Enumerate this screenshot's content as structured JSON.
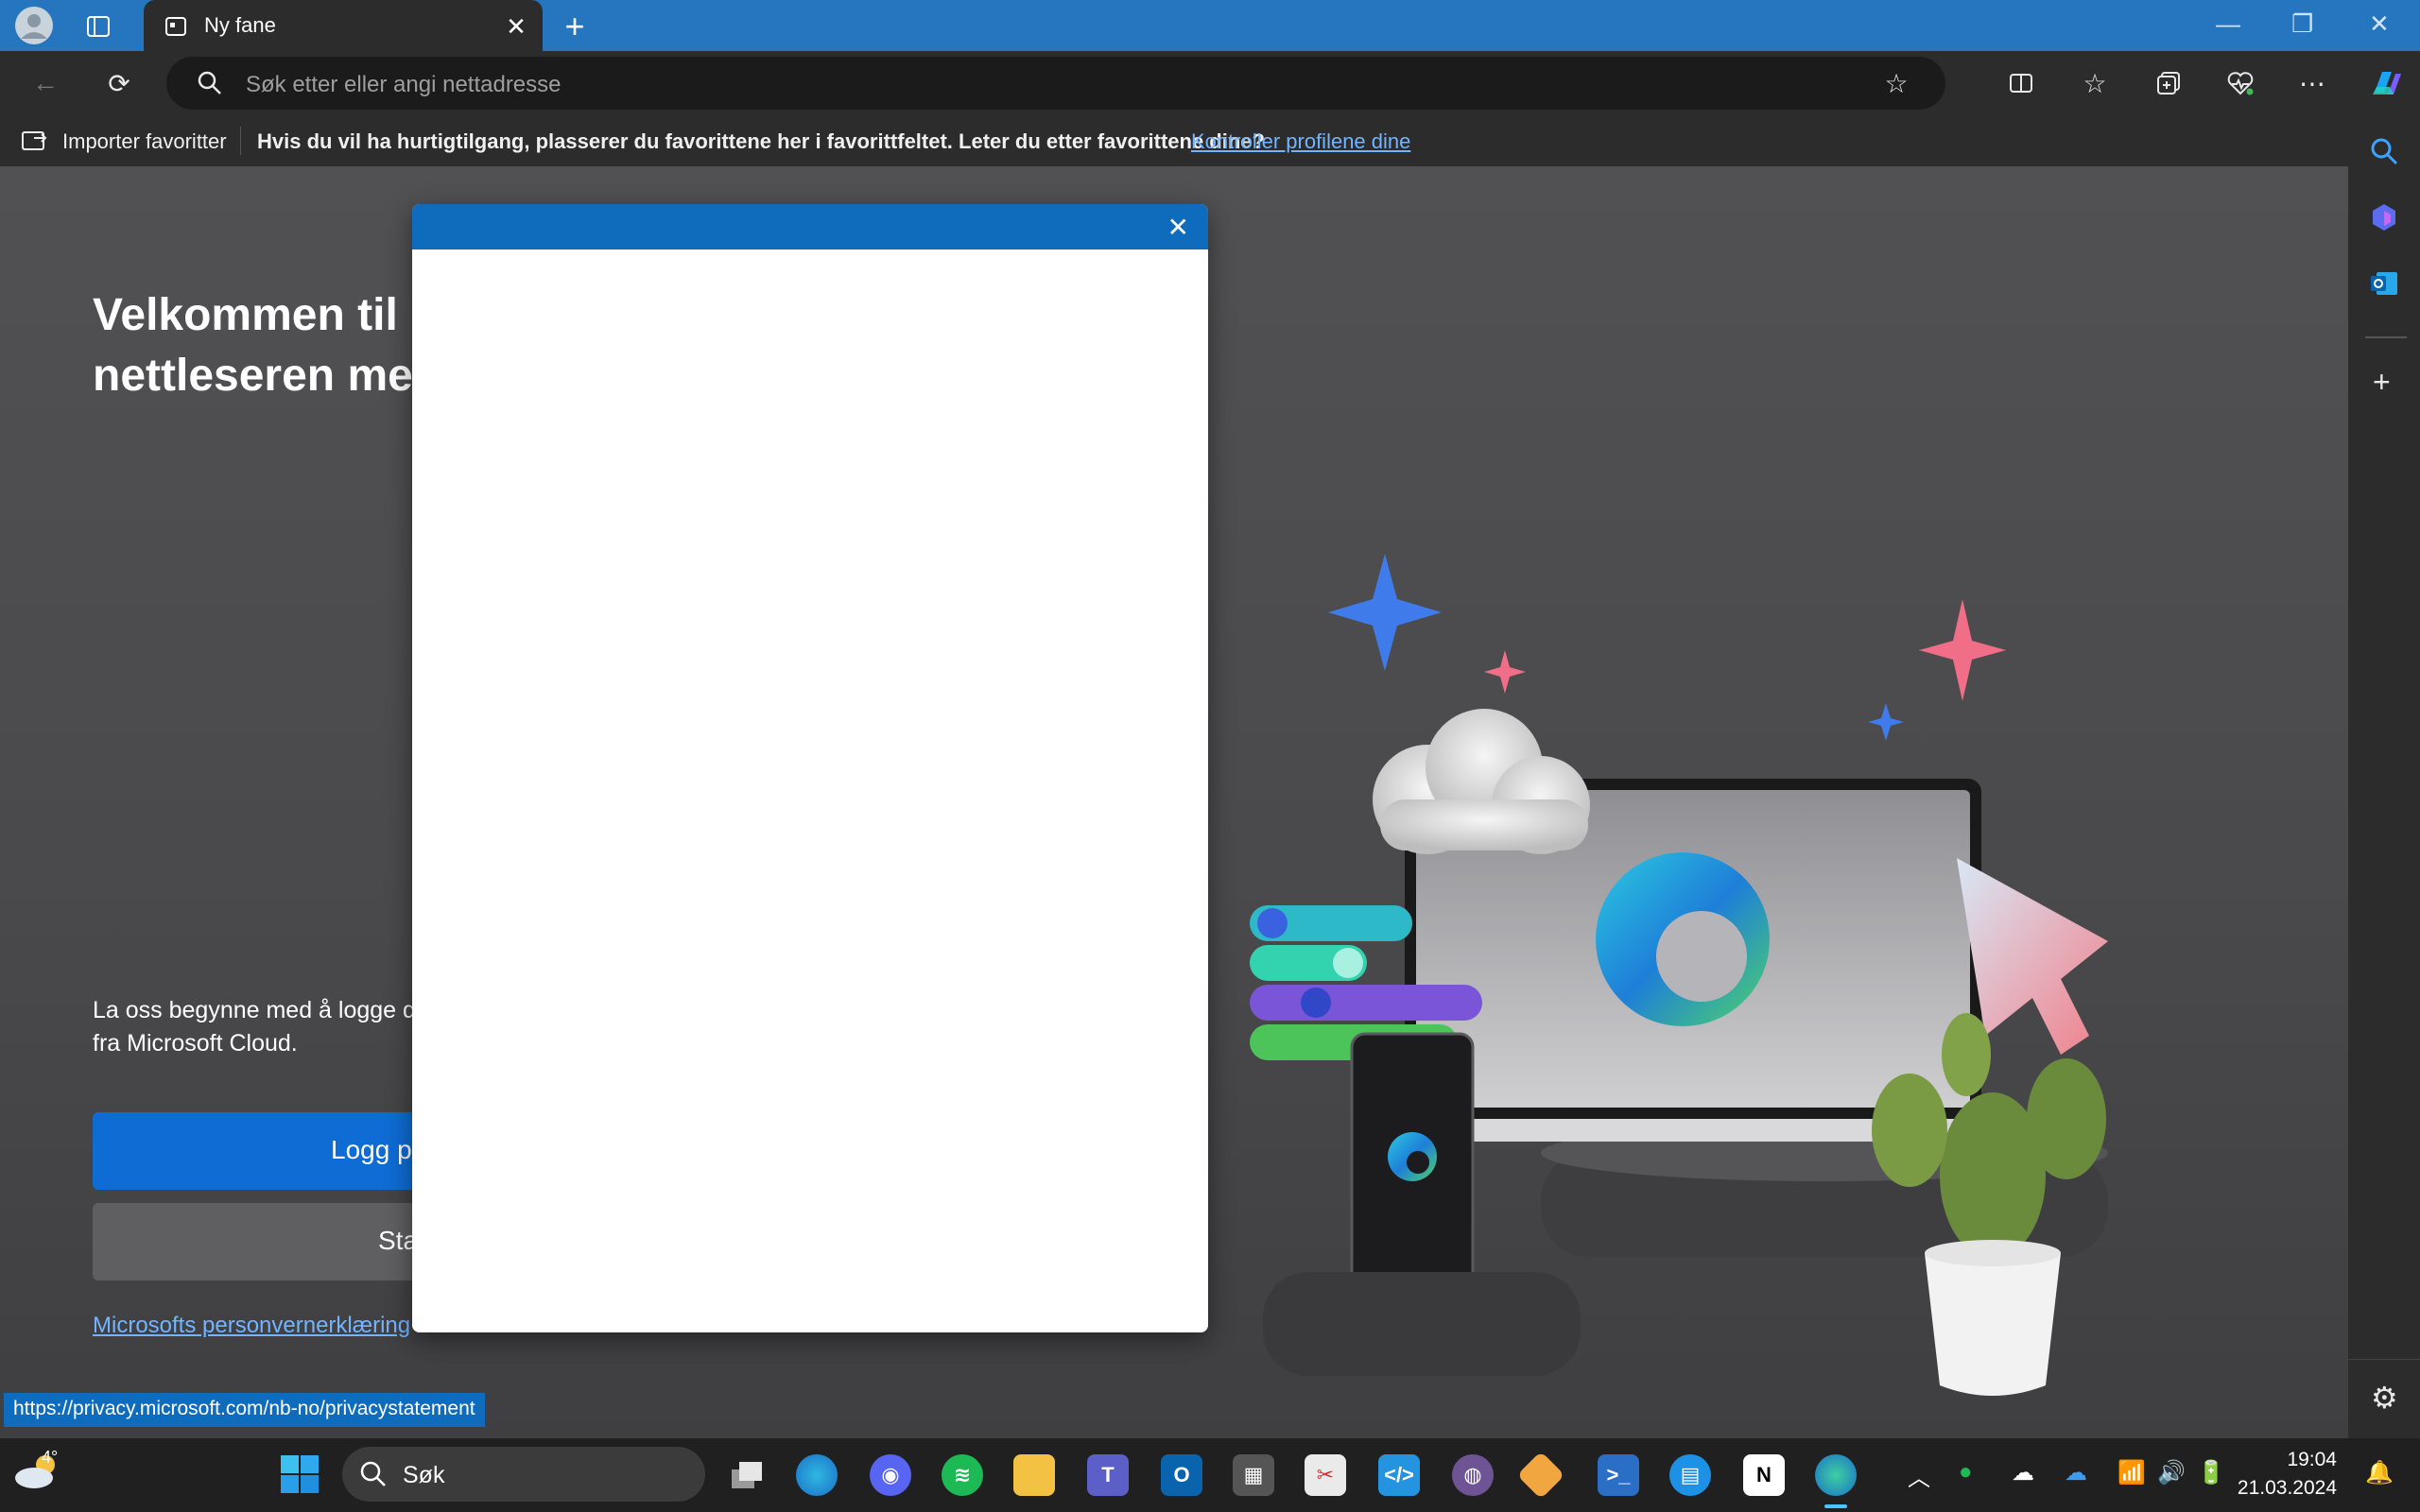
{
  "browser": {
    "tab_title": "Ny fane",
    "address_placeholder": "Søk etter eller angi nettadresse"
  },
  "favorites_bar": {
    "import_label": "Importer favoritter",
    "message": "Hvis du vil ha hurtigtilgang, plasserer du favorittene her i favorittfeltet. Leter du etter favorittene dine?",
    "link": "Kontroller profilene dine"
  },
  "welcome": {
    "title": "Velkommen til l\nnettleseren mec",
    "body": "La oss begynne med å logge d\nfra Microsoft Cloud.",
    "signin_label": "Logg p",
    "start_label": "Sta",
    "privacy_link": "Microsofts personvernerklæring"
  },
  "status_url": "https://privacy.microsoft.com/nb-no/privacystatement",
  "taskbar": {
    "weather_temp": "4°",
    "search_label": "Søk",
    "time": "19:04",
    "date": "21.03.2024"
  },
  "colors": {
    "accent": "#2675bf",
    "modal_header": "#0f6cbd",
    "signin_button": "#0e6cd4",
    "link": "#72b4ff"
  }
}
